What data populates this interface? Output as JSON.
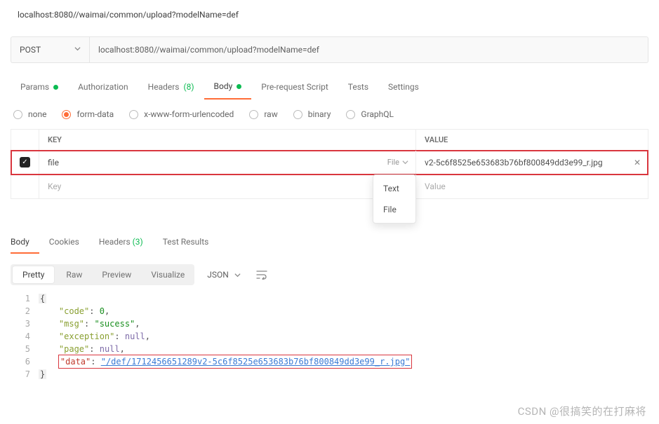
{
  "topUrl": "localhost:8080//waimai/common/upload?modelName=def",
  "request": {
    "method": "POST",
    "url": "localhost:8080//waimai/common/upload?modelName=def"
  },
  "reqTabs": {
    "params": "Params",
    "authorization": "Authorization",
    "headers": "Headers",
    "headersCount": "(8)",
    "body": "Body",
    "prerequest": "Pre-request Script",
    "tests": "Tests",
    "settings": "Settings"
  },
  "bodyModes": {
    "none": "none",
    "formdata": "form-data",
    "xwww": "x-www-form-urlencoded",
    "raw": "raw",
    "binary": "binary",
    "graphql": "GraphQL"
  },
  "kv": {
    "headerKey": "KEY",
    "headerValue": "VALUE",
    "row0": {
      "key": "file",
      "type": "File",
      "value": "v2-5c6f8525e653683b76bf800849dd3e99_r.jpg"
    },
    "placeholderKey": "Key",
    "placeholderValue": "Value",
    "dropdown": {
      "text": "Text",
      "file": "File"
    }
  },
  "respTabs": {
    "body": "Body",
    "cookies": "Cookies",
    "headers": "Headers",
    "headersCount": "(3)",
    "testresults": "Test Results"
  },
  "viewModes": {
    "pretty": "Pretty",
    "raw": "Raw",
    "preview": "Preview",
    "visualize": "Visualize",
    "format": "JSON"
  },
  "responseJson": {
    "line1": "{",
    "k_code": "\"code\"",
    "v_code": "0",
    "k_msg": "\"msg\"",
    "v_msg": "\"sucess\"",
    "k_exc": "\"exception\"",
    "v_exc": "null",
    "k_page": "\"page\"",
    "v_page": "null",
    "k_data": "\"data\"",
    "v_data": "\"/def/1712456651289v2-5c6f8525e653683b76bf800849dd3e99_r.jpg\"",
    "line7": "}"
  },
  "lineNumbers": [
    "1",
    "2",
    "3",
    "4",
    "5",
    "6",
    "7"
  ],
  "watermark": "CSDN @很搞笑的在打麻将"
}
